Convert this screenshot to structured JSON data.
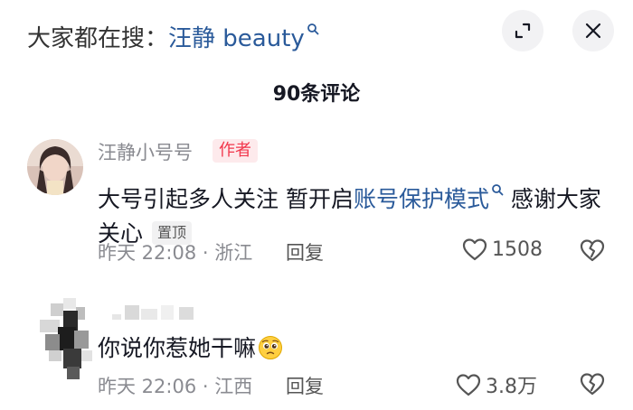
{
  "search_hint": {
    "prefix": "大家都在搜：",
    "term": "汪静 beauty"
  },
  "header": {
    "comment_count": "90条评论"
  },
  "comments": [
    {
      "username": "汪静小号号",
      "badge": "作者",
      "text_before": "大号引起多人关注 暂开启",
      "link_text": "账号保护模式",
      "text_after": "感谢大家关心",
      "pin_label": "置顶",
      "meta": "昨天 22:08 · 浙江",
      "reply_label": "回复",
      "likes": "1508"
    },
    {
      "username": "",
      "text": "你说你惹她干嘛",
      "meta": "昨天 22:06 · 江西",
      "reply_label": "回复",
      "likes": "3.8万"
    }
  ],
  "colors": {
    "link": "#2a5a9a",
    "author_badge": "#f2374c",
    "muted": "#8a8b91"
  },
  "icons": [
    "search-icon",
    "expand-icon",
    "close-icon",
    "heart-icon",
    "broken-heart-icon",
    "pleading-face-emoji"
  ]
}
